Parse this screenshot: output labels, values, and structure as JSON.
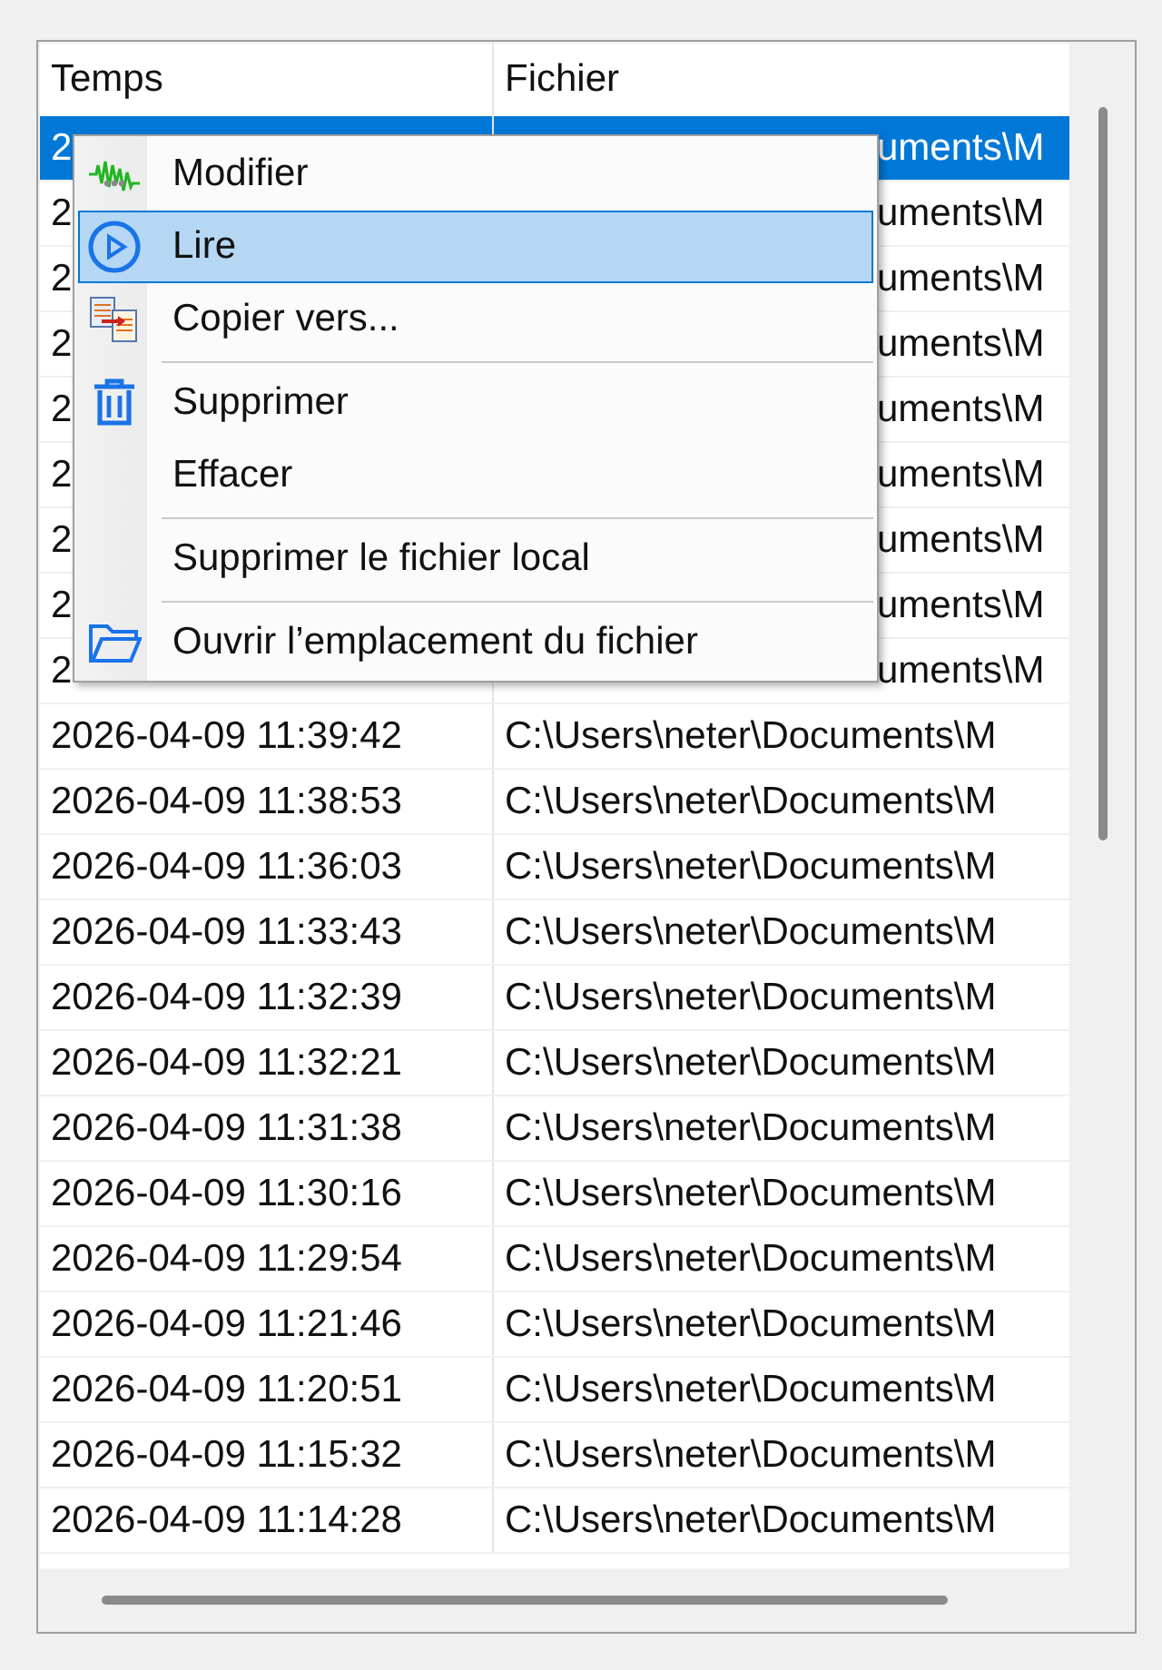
{
  "table": {
    "columns": [
      "Temps",
      "Fichier"
    ],
    "rows": [
      {
        "kind": "covered",
        "time": "2",
        "file": "uments\\M",
        "selected": true
      },
      {
        "kind": "covered",
        "time": "2",
        "file": "uments\\M",
        "selected": false
      },
      {
        "kind": "covered",
        "time": "2",
        "file": "uments\\M",
        "selected": false
      },
      {
        "kind": "covered",
        "time": "2",
        "file": "uments\\M",
        "selected": false
      },
      {
        "kind": "covered",
        "time": "2",
        "file": "uments\\M",
        "selected": false
      },
      {
        "kind": "covered",
        "time": "2",
        "file": "uments\\M",
        "selected": false
      },
      {
        "kind": "covered",
        "time": "2",
        "file": "uments\\M",
        "selected": false
      },
      {
        "kind": "covered",
        "time": "2",
        "file": "uments\\M",
        "selected": false
      },
      {
        "kind": "covered",
        "time": "2",
        "file": "uments\\M",
        "selected": false
      },
      {
        "kind": "full",
        "time": "2026-04-09 11:39:42",
        "file": "C:\\Users\\neter\\Documents\\M",
        "selected": false
      },
      {
        "kind": "full",
        "time": "2026-04-09 11:38:53",
        "file": "C:\\Users\\neter\\Documents\\M",
        "selected": false
      },
      {
        "kind": "full",
        "time": "2026-04-09 11:36:03",
        "file": "C:\\Users\\neter\\Documents\\M",
        "selected": false
      },
      {
        "kind": "full",
        "time": "2026-04-09 11:33:43",
        "file": "C:\\Users\\neter\\Documents\\M",
        "selected": false
      },
      {
        "kind": "full",
        "time": "2026-04-09 11:32:39",
        "file": "C:\\Users\\neter\\Documents\\M",
        "selected": false
      },
      {
        "kind": "full",
        "time": "2026-04-09 11:32:21",
        "file": "C:\\Users\\neter\\Documents\\M",
        "selected": false
      },
      {
        "kind": "full",
        "time": "2026-04-09 11:31:38",
        "file": "C:\\Users\\neter\\Documents\\M",
        "selected": false
      },
      {
        "kind": "full",
        "time": "2026-04-09 11:30:16",
        "file": "C:\\Users\\neter\\Documents\\M",
        "selected": false
      },
      {
        "kind": "full",
        "time": "2026-04-09 11:29:54",
        "file": "C:\\Users\\neter\\Documents\\M",
        "selected": false
      },
      {
        "kind": "full",
        "time": "2026-04-09 11:21:46",
        "file": "C:\\Users\\neter\\Documents\\M",
        "selected": false
      },
      {
        "kind": "full",
        "time": "2026-04-09 11:20:51",
        "file": "C:\\Users\\neter\\Documents\\M",
        "selected": false
      },
      {
        "kind": "full",
        "time": "2026-04-09 11:15:32",
        "file": "C:\\Users\\neter\\Documents\\M",
        "selected": false
      },
      {
        "kind": "full",
        "time": "2026-04-09 11:14:28",
        "file": "C:\\Users\\neter\\Documents\\M",
        "selected": false
      }
    ]
  },
  "context_menu": {
    "items": [
      {
        "kind": "item",
        "label": "Modifier",
        "selected": false
      },
      {
        "kind": "item",
        "label": "Lire",
        "selected": true
      },
      {
        "kind": "item",
        "label": "Copier vers...",
        "selected": false
      },
      {
        "kind": "separator"
      },
      {
        "kind": "item",
        "label": "Supprimer",
        "selected": false
      },
      {
        "kind": "item",
        "label": "Effacer",
        "selected": false
      },
      {
        "kind": "separator"
      },
      {
        "kind": "item",
        "label": "Supprimer le fichier local",
        "selected": false
      },
      {
        "kind": "separator"
      },
      {
        "kind": "item",
        "label": "Ouvrir l’emplacement du fichier",
        "selected": false
      }
    ]
  }
}
